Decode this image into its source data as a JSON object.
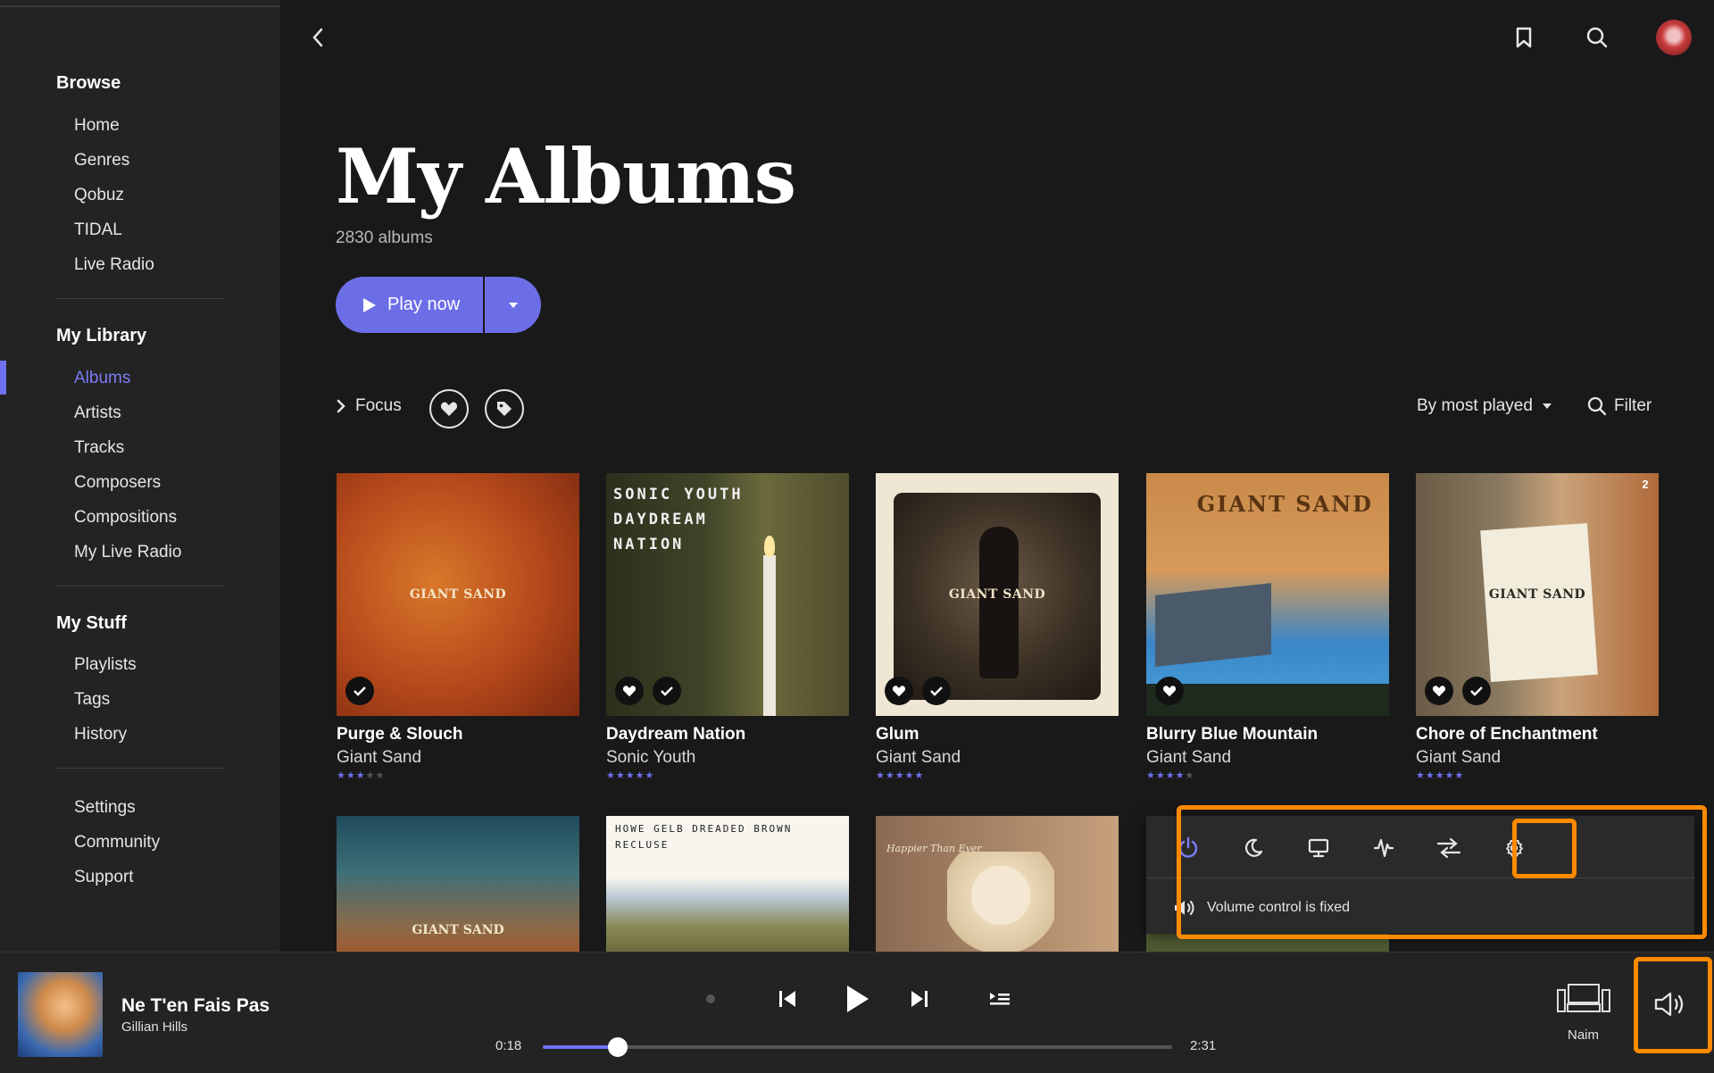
{
  "sidebar": {
    "sections": [
      {
        "title": "Browse",
        "items": [
          "Home",
          "Genres",
          "Qobuz",
          "TIDAL",
          "Live Radio"
        ]
      },
      {
        "title": "My Library",
        "items": [
          "Albums",
          "Artists",
          "Tracks",
          "Composers",
          "Compositions",
          "My Live Radio"
        ]
      },
      {
        "title": "My Stuff",
        "items": [
          "Playlists",
          "Tags",
          "History"
        ]
      },
      {
        "title": "",
        "items": [
          "Settings",
          "Community",
          "Support"
        ]
      }
    ],
    "active_item": "Albums"
  },
  "main": {
    "title": "My Albums",
    "count": "2830 albums",
    "play_label": "Play now",
    "focus_label": "Focus",
    "sort_label": "By most played",
    "filter_label": "Filter"
  },
  "albums": [
    {
      "title": "Purge & Slouch",
      "artist": "Giant Sand",
      "rating": 3,
      "cover_text": "GIANT SAND",
      "favorite": false,
      "owned": true
    },
    {
      "title": "Daydream Nation",
      "artist": "Sonic Youth",
      "rating": 5,
      "cover_text": "SONIC YOUTH DAYDREAM NATION",
      "favorite": true,
      "owned": true
    },
    {
      "title": "Glum",
      "artist": "Giant Sand",
      "rating": 5,
      "cover_text": "GIANT SAND",
      "favorite": true,
      "owned": true
    },
    {
      "title": "Blurry Blue Mountain",
      "artist": "Giant Sand",
      "rating": 4,
      "cover_text": "GIANT SAND",
      "favorite": true,
      "owned": false
    },
    {
      "title": "Chore of Enchantment",
      "artist": "Giant Sand",
      "rating": 5,
      "cover_text": "GIANT SAND",
      "favorite": true,
      "owned": true,
      "disc_count": "2"
    }
  ],
  "second_row_cover_texts": [
    "GIANT SAND",
    "HOWE GELB DREADED BROWN RECLUSE",
    "Happier Than Ever"
  ],
  "popup": {
    "volume_text": "Volume control is fixed",
    "icons": [
      "power-icon",
      "moon-icon",
      "display-icon",
      "audio-wave-icon",
      "transfer-icon",
      "settings-icon"
    ]
  },
  "player": {
    "track_title": "Ne T'en Fais Pas",
    "track_artist": "Gillian Hills",
    "elapsed": "0:18",
    "duration": "2:31",
    "progress": 0.119,
    "device": "Naim"
  },
  "colors": {
    "accent": "#6c6ee8",
    "highlight": "#ff8a00",
    "background": "#191919",
    "sidebar": "#232323"
  }
}
